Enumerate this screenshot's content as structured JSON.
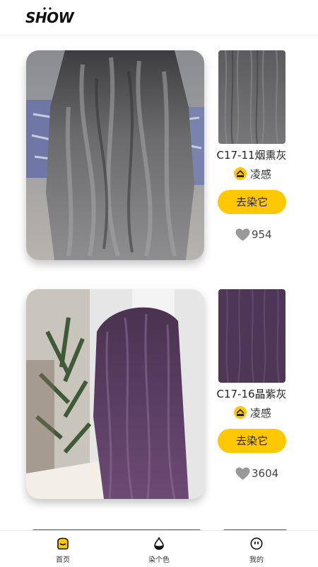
{
  "header": {
    "logo_text": "SHOW"
  },
  "cards": [
    {
      "color_name": "C17-11烟熏灰",
      "brand": "凌感",
      "button_label": "去染它",
      "likes": "954",
      "hair_color": "#6f6f71"
    },
    {
      "color_name": "C17-16晶紫灰",
      "brand": "凌感",
      "button_label": "去染它",
      "likes": "3604",
      "hair_color": "#5a3c60"
    }
  ],
  "tabbar": {
    "items": [
      {
        "label": "首页",
        "icon": "home-icon",
        "active": true
      },
      {
        "label": "染个色",
        "icon": "drop-icon",
        "active": false
      },
      {
        "label": "我的",
        "icon": "smiley-icon",
        "active": false
      }
    ]
  },
  "colors": {
    "accent": "#ffc800",
    "heart": "#999999"
  }
}
